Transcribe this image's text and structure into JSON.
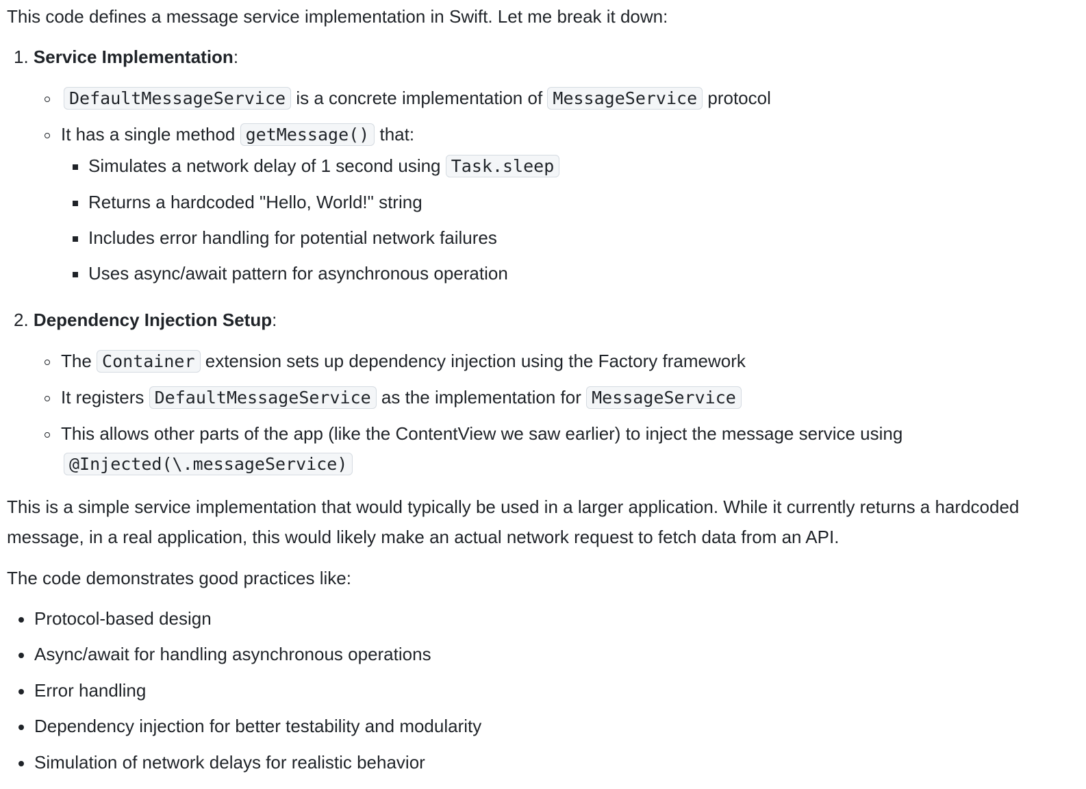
{
  "intro": "This code defines a message service implementation in Swift. Let me break it down:",
  "sections": [
    {
      "number": "1.",
      "title": "Service Implementation",
      "colon": ":",
      "items": [
        {
          "code1": "DefaultMessageService",
          "text1": "is a concrete implementation of",
          "code2": "MessageService",
          "text2": "protocol"
        },
        {
          "text1": "It has a single method",
          "code1": "getMessage()",
          "text2": "that:",
          "subitems": [
            {
              "text": "Simulates a network delay of 1 second using",
              "code": "Task.sleep"
            },
            {
              "text": "Returns a hardcoded \"Hello, World!\" string"
            },
            {
              "text": "Includes error handling for potential network failures"
            },
            {
              "text": "Uses async/await pattern for asynchronous operation"
            }
          ]
        }
      ]
    },
    {
      "number": "2.",
      "title": "Dependency Injection Setup",
      "colon": ":",
      "items": [
        {
          "text1": "The",
          "code1": "Container",
          "text2": "extension sets up dependency injection using the Factory framework"
        },
        {
          "text1": "It registers",
          "code1": "DefaultMessageService",
          "text2": "as the implementation for",
          "code2": "MessageService"
        },
        {
          "text1": "This allows other parts of the app (like the ContentView we saw earlier) to inject the message service using",
          "code1": "@Injected(\\.messageService)"
        }
      ]
    }
  ],
  "summary": "This is a simple service implementation that would typically be used in a larger application. While it currently returns a hardcoded message, in a real application, this would likely make an actual network request to fetch data from an API.",
  "practices_intro": "The code demonstrates good practices like:",
  "practices": [
    "Protocol-based design",
    "Async/await for handling asynchronous operations",
    "Error handling",
    "Dependency injection for better testability and modularity",
    "Simulation of network delays for realistic behavior"
  ]
}
